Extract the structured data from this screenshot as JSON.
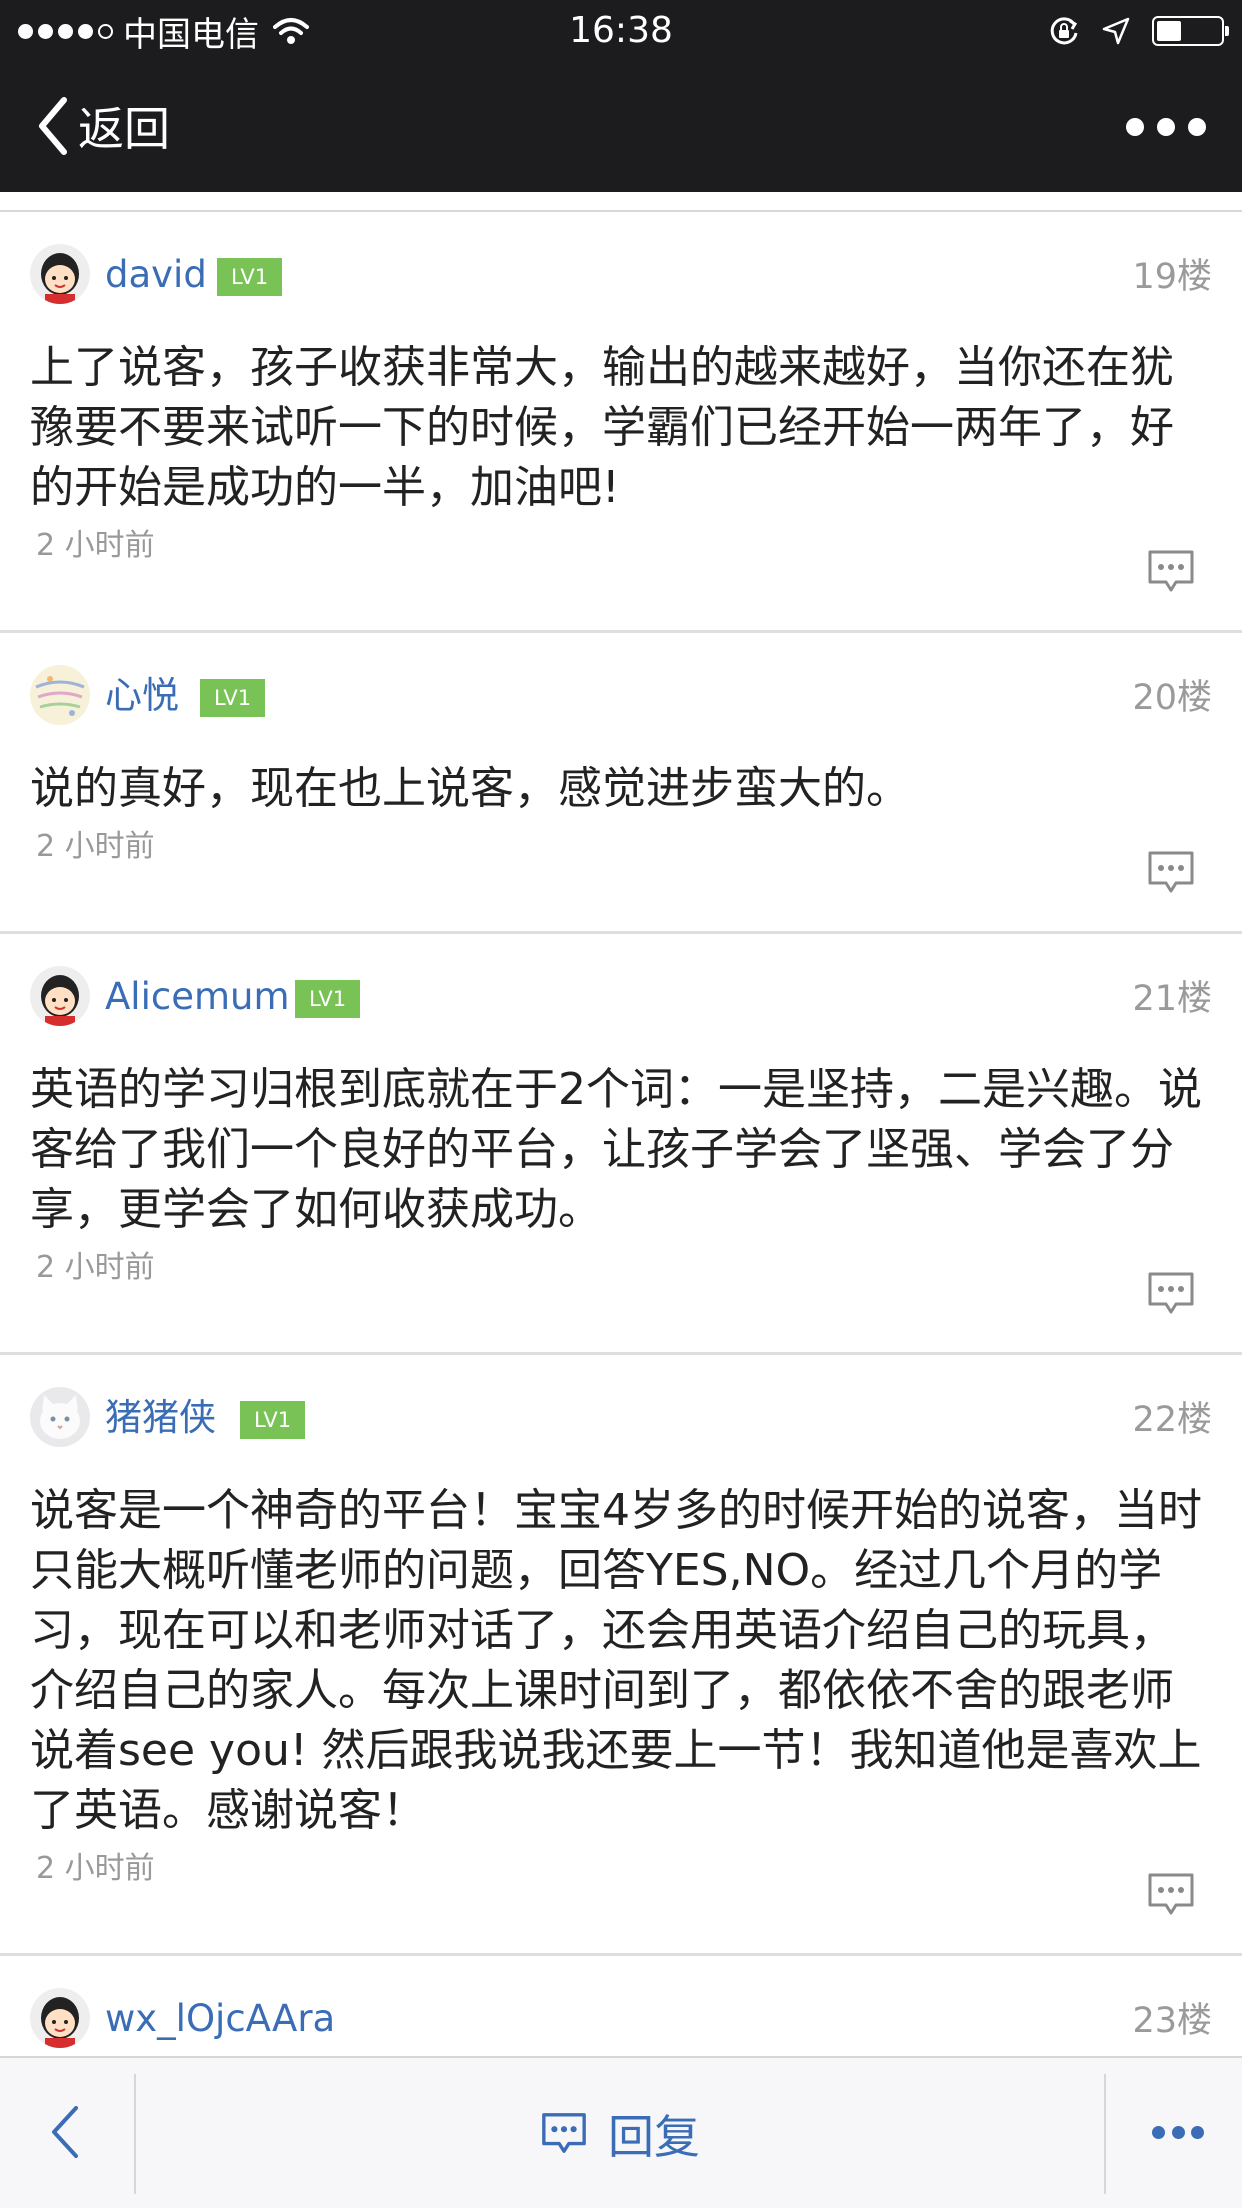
{
  "status_bar": {
    "carrier": "中国电信",
    "time": "16:38"
  },
  "nav": {
    "back_label": "返回"
  },
  "posts": [
    {
      "username": "david",
      "level": "LV1",
      "floor": "19楼",
      "content": "上了说客，孩子收获非常大，输出的越来越好，当你还在犹豫要不要来试听一下的时候，学霸们已经开始一两年了，好的开始是成功的一半，加油吧!",
      "time": "2 小时前"
    },
    {
      "username": "心悦",
      "level": "LV1",
      "floor": "20楼",
      "content": "说的真好，现在也上说客，感觉进步蛮大的。",
      "time": "2 小时前"
    },
    {
      "username": "Alicemum",
      "level": "LV1",
      "floor": "21楼",
      "content": "英语的学习归根到底就在于2个词：一是坚持，二是兴趣。说客给了我们一个良好的平台，让孩子学会了坚强、学会了分享，更学会了如何收获成功。",
      "time": "2 小时前"
    },
    {
      "username": "猪猪侠",
      "level": "LV1",
      "floor": "22楼",
      "content": "说客是一个神奇的平台！宝宝4岁多的时候开始的说客，当时只能大概听懂老师的问题，回答YES,NO。经过几个月的学习，现在可以和老师对话了，还会用英语介绍自己的玩具，介绍自己的家人。每次上课时间到了，都依依不舍的跟老师说着see you! 然后跟我说我还要上一节！我知道他是喜欢上了英语。感谢说客！",
      "time": "2 小时前"
    },
    {
      "username": "wx_lOjcAAra",
      "floor": "23楼"
    }
  ],
  "bottom_bar": {
    "reply_label": "回复"
  },
  "colors": {
    "bar_background": "#1c1c1e",
    "username": "#3a6db6",
    "level_badge": "#79c256",
    "meta_text": "#999999"
  },
  "icons": {
    "back": "chevron-left-icon",
    "more": "ellipsis-icon",
    "comment": "speech-bubble-icon",
    "reply": "speech-bubble-icon"
  }
}
